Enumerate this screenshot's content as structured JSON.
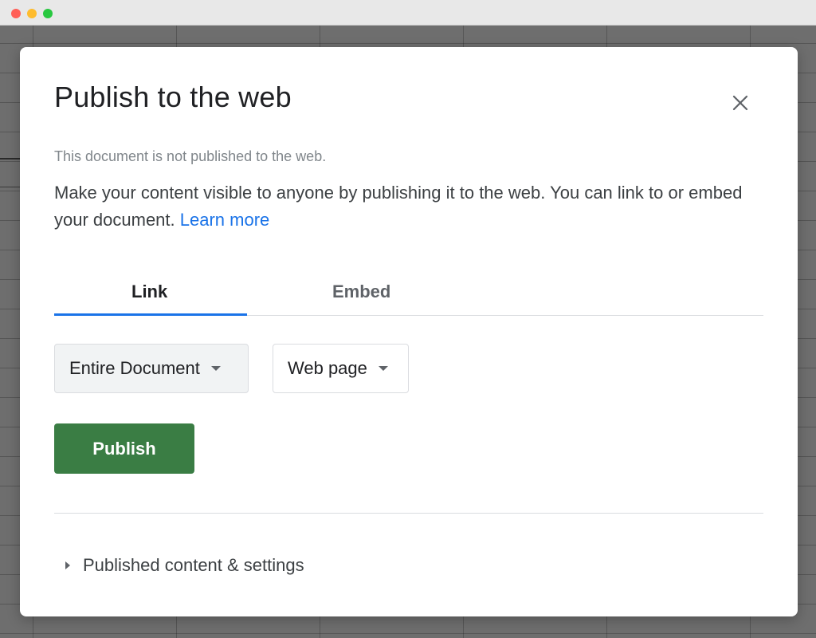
{
  "dialog": {
    "title": "Publish to the web",
    "close_icon": "close-icon",
    "status": "This document is not published to the web.",
    "description": "Make your content visible to anyone by publishing it to the web. You can link to or embed your document.",
    "learn_more": "Learn more"
  },
  "tabs": [
    {
      "label": "Link",
      "selected": true
    },
    {
      "label": "Embed",
      "selected": false
    }
  ],
  "scope_dropdown": {
    "value": "Entire Document",
    "icon": "dropdown-arrow-icon"
  },
  "format_dropdown": {
    "value": "Web page",
    "icon": "dropdown-arrow-icon"
  },
  "publish_button": {
    "label": "Publish"
  },
  "settings_section": {
    "label": "Published content & settings",
    "icon": "expand-arrow-icon"
  },
  "colors": {
    "accent": "#1a73e8",
    "publish_button": "#3a7d44",
    "title_text": "#202124",
    "status_text": "#80868b"
  }
}
